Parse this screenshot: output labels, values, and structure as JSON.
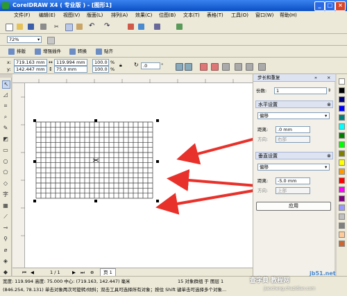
{
  "window": {
    "title": "CorelDRAW X4 ( 专业版 ) - [图形1]"
  },
  "menu": [
    "文件(F)",
    "编辑(E)",
    "视图(V)",
    "版面(L)",
    "排列(A)",
    "效果(C)",
    "位图(B)",
    "文本(T)",
    "表格(T)",
    "工具(O)",
    "窗口(W)",
    "帮助(H)"
  ],
  "standard_toolbar": {
    "zoom": "72%"
  },
  "tabs": [
    "排版",
    "增强插件",
    "转换",
    "贴齐"
  ],
  "property_bar": {
    "x_label": "x:",
    "x_value": "719.163 mm",
    "y_label": "y:",
    "y_value": "142.447 mm",
    "w_value": "119.994 mm",
    "h_value": "75.0 mm",
    "scale_x": "100.0",
    "scale_y": "100.0",
    "percent": "%",
    "rotation": ".0",
    "degree": "°"
  },
  "docker": {
    "title": "步长和重复",
    "copies_label": "份数:",
    "copies_value": "1",
    "horizontal": {
      "header": "水平设置",
      "mode": "偏移",
      "distance_label": "距离:",
      "distance_value": ".0 mm",
      "direction_label": "方向:",
      "direction_value": "右部"
    },
    "vertical": {
      "header": "垂直设置",
      "mode": "偏移",
      "distance_label": "距离:",
      "distance_value": "-5.0 mm",
      "direction_label": "方向:",
      "direction_value": "上部"
    },
    "apply_label": "应用"
  },
  "page_nav": {
    "page_count": "1 / 1",
    "page_tab": "页 1"
  },
  "status": {
    "line1": "宽度: 119.994 高度: 75.000 中心: (719.163, 142.447) 毫米",
    "group_info": "15 对象群组 于 图层 1",
    "line2": "(846.254, 78.131)    单击对象两次可旋转/倾斜；双击工具可选择所有对象；按住 Shift 键单击可选择多个对象..."
  },
  "watermark": {
    "site": "jb51.net",
    "name": "查字典 教程网",
    "url": "jiaocheng.chazidian.com"
  },
  "palette_colors": [
    "#ffffff",
    "#000000",
    "#00007f",
    "#0000ff",
    "#007f7f",
    "#00ffff",
    "#007f00",
    "#00ff00",
    "#7f7f00",
    "#ffff00",
    "#ff9900",
    "#ff0000",
    "#ff00ff",
    "#7f007f",
    "#9999ff",
    "#c0c0c0",
    "#808080",
    "#ffcc99",
    "#cc6633"
  ]
}
